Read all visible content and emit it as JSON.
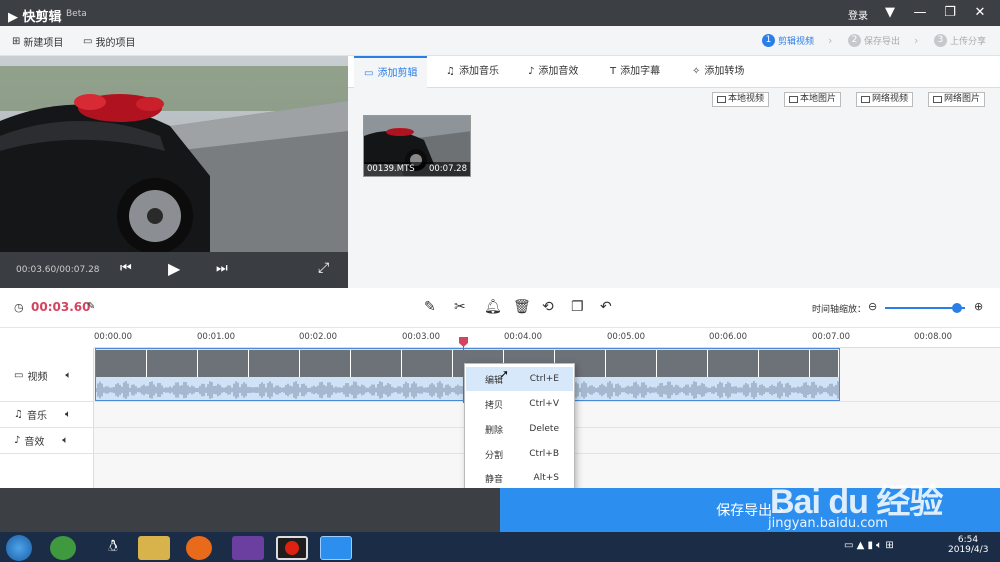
{
  "titlebar": {
    "app_name": "快剪辑",
    "beta": "Beta",
    "login": "登录"
  },
  "toolbar": {
    "new_project": "新建项目",
    "my_projects": "我的项目"
  },
  "steps": [
    {
      "num": "1",
      "label": "剪辑视频"
    },
    {
      "num": "2",
      "label": "保存导出"
    },
    {
      "num": "3",
      "label": "上传分享"
    }
  ],
  "preview": {
    "time": "00:03.60/00:07.28"
  },
  "tabs": [
    {
      "label": "添加剪辑"
    },
    {
      "label": "添加音乐"
    },
    {
      "label": "添加音效"
    },
    {
      "label": "添加字幕"
    },
    {
      "label": "添加转场"
    }
  ],
  "sources": [
    {
      "label": "本地视频"
    },
    {
      "label": "本地图片"
    },
    {
      "label": "网络视频"
    },
    {
      "label": "网络图片"
    }
  ],
  "clip": {
    "name": "00139.MTS",
    "duration": "00:07.28"
  },
  "editbar": {
    "current_time": "00:03.60",
    "zoom_label": "时间轴缩放：",
    "zoom_level": 0.9
  },
  "ruler": {
    "ticks": [
      "00:00.00",
      "00:01.00",
      "00:02.00",
      "00:03.00",
      "00:04.00",
      "00:05.00",
      "00:06.00",
      "00:07.00",
      "00:08.00"
    ]
  },
  "tracks": [
    {
      "label": "视频"
    },
    {
      "label": "音乐"
    },
    {
      "label": "音效"
    }
  ],
  "context_menu": [
    {
      "label": "编辑",
      "shortcut": "Ctrl+E"
    },
    {
      "label": "拷贝",
      "shortcut": "Ctrl+V"
    },
    {
      "label": "删除",
      "shortcut": "Delete"
    },
    {
      "label": "分割",
      "shortcut": "Ctrl+B"
    },
    {
      "label": "静音",
      "shortcut": "Alt+S"
    }
  ],
  "save": {
    "label": "保存导出"
  },
  "taskbar": {
    "time": "6:54",
    "date": "2019/4/3"
  },
  "watermark": {
    "brand": "Bai du 经验",
    "url": "jingyan.baidu.com"
  },
  "colors": {
    "accent": "#2a7ee8",
    "titlebar": "#3c3f44",
    "playhead": "#d3445e",
    "save": "#2c8ff0"
  }
}
